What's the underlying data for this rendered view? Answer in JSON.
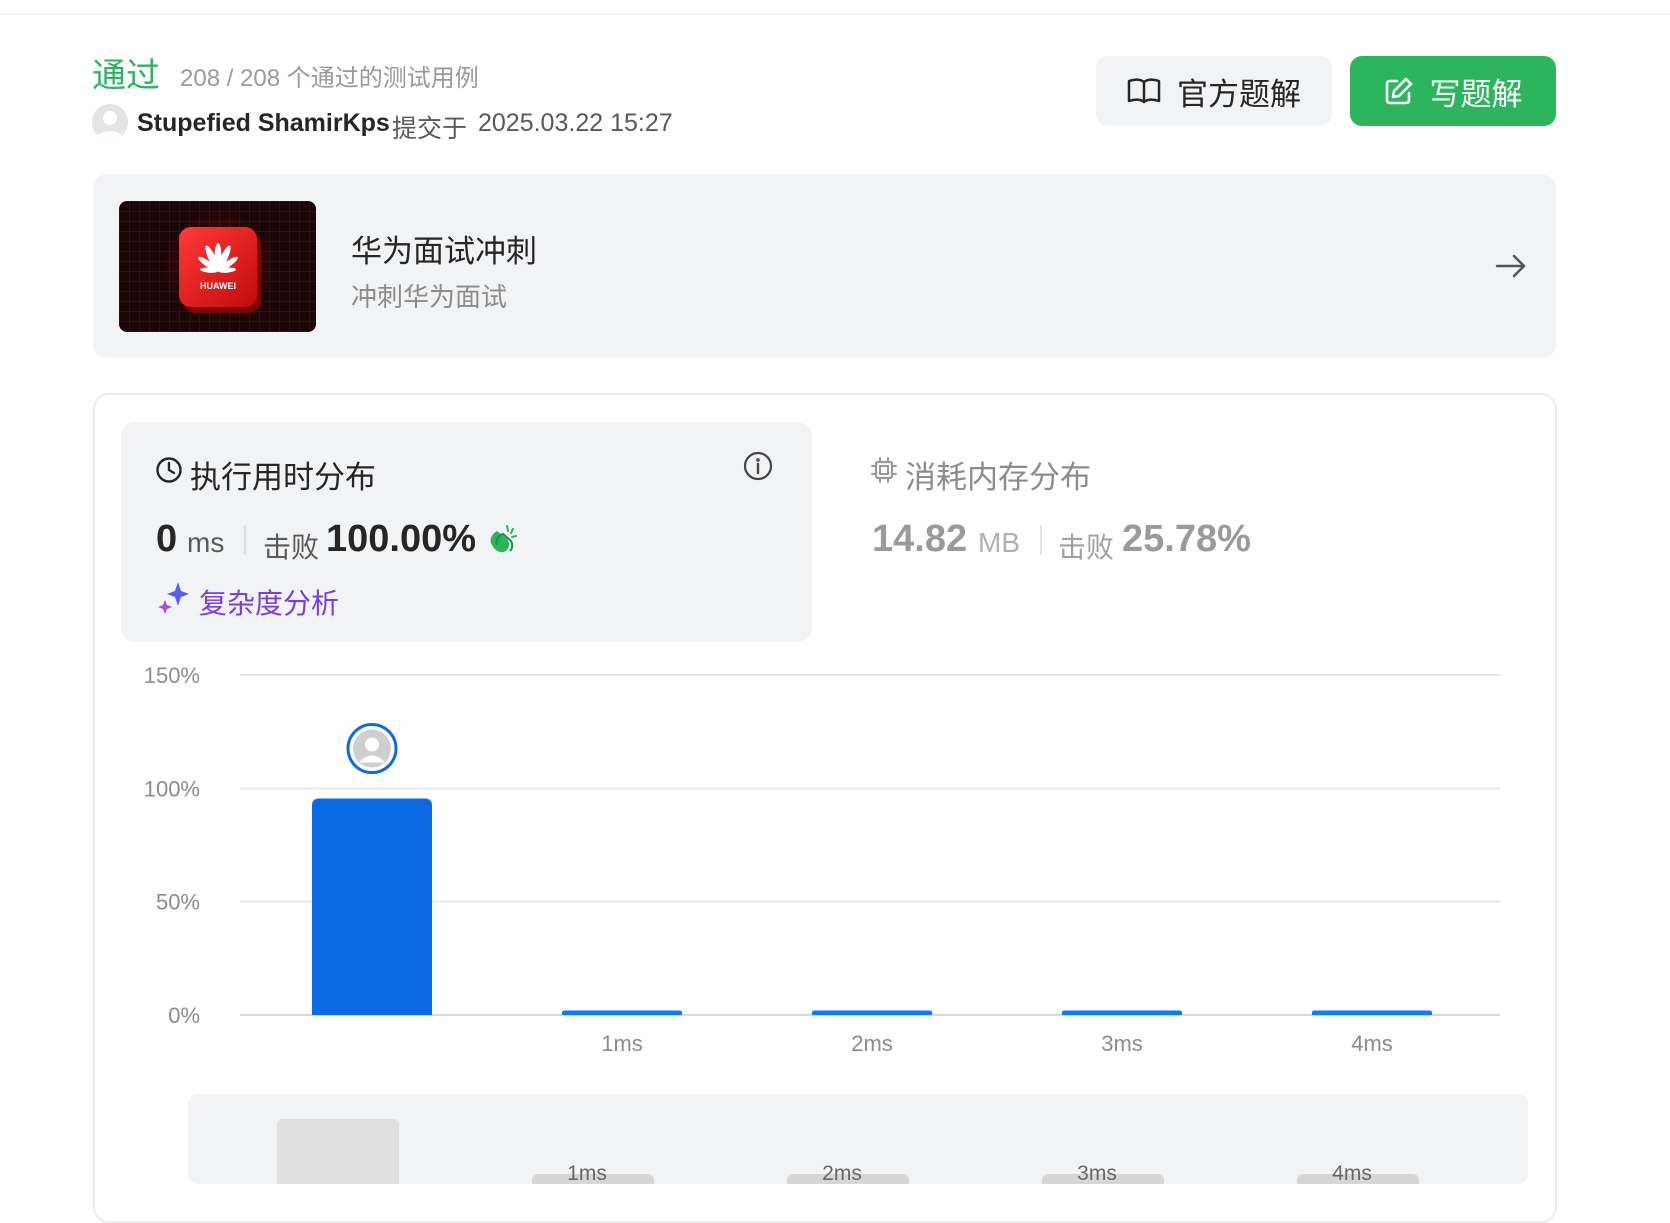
{
  "submission": {
    "status": "通过",
    "cases": "208 / 208 个通过的测试用例",
    "user": "Stupefied ShamirKps",
    "submit_word": "提交于",
    "submit_time": "2025.03.22 15:27"
  },
  "buttons": {
    "official_solution": "官方题解",
    "write_solution": "写题解"
  },
  "banner": {
    "title": "华为面试冲刺",
    "subtitle": "冲刺华为面试",
    "logo_text": "HUAWEI"
  },
  "runtime": {
    "title": "执行用时分布",
    "value": "0",
    "unit": "ms",
    "beat_label": "击败",
    "beat_value": "100.00%",
    "complexity_link": "复杂度分析"
  },
  "memory": {
    "title": "消耗内存分布",
    "value": "14.82",
    "unit": "MB",
    "beat_label": "击败",
    "beat_value": "25.78%"
  },
  "colors": {
    "accent_green": "#2db55d",
    "bar_blue": "#0b6be5",
    "complexity_purple": "#7a3ce8"
  },
  "chart_data": {
    "type": "bar",
    "categories": [
      "0ms",
      "1ms",
      "2ms",
      "3ms",
      "4ms"
    ],
    "x_tick_labels": [
      "",
      "1ms",
      "2ms",
      "3ms",
      "4ms"
    ],
    "values": [
      95.5,
      2,
      2,
      2,
      2
    ],
    "ylim": [
      0,
      150
    ],
    "y_ticks": [
      "0%",
      "50%",
      "100%",
      "150%"
    ],
    "y_tick_values": [
      0,
      50,
      100,
      150
    ],
    "grid": true,
    "highlight_category": "0ms",
    "navigator_labels": [
      "",
      "1ms",
      "2ms",
      "3ms",
      "4ms"
    ]
  }
}
